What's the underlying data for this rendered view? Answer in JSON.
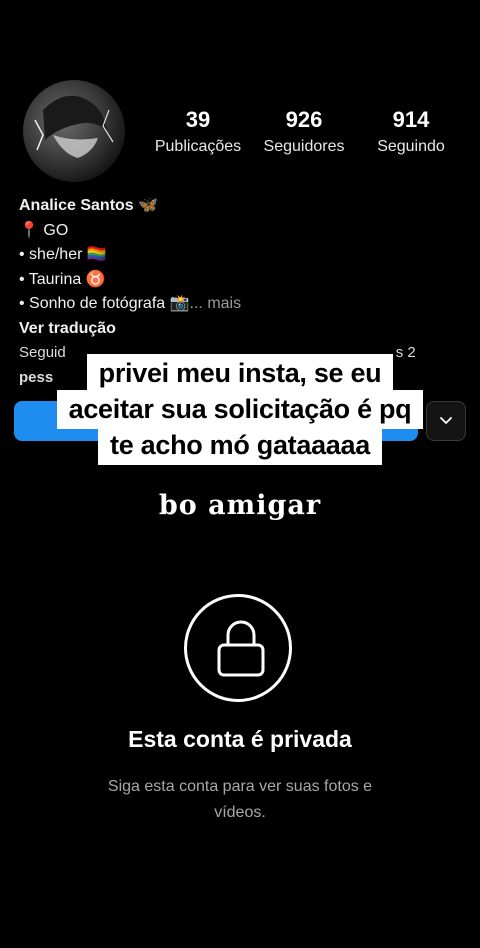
{
  "profile": {
    "stats": [
      {
        "value": "39",
        "label": "Publicações"
      },
      {
        "value": "926",
        "label": "Seguidores"
      },
      {
        "value": "914",
        "label": "Seguindo"
      }
    ],
    "bio": {
      "name": "Analice Santos 🦋",
      "location": "📍 GO",
      "pronouns": "• she/her 🏳️‍🌈",
      "sign": "• Taurina ♉",
      "dream": "• Sonho de fotógrafa 📸",
      "more": "... mais",
      "translate": "Ver tradução",
      "followed_by_line1": "Seguid",
      "followed_by_tail": "s 2",
      "followed_by_line2": "pess"
    }
  },
  "caption": {
    "line1": "privei meu insta, se eu",
    "line2": "aceitar sua solicitação é pq",
    "line3": "te acho mó gataaaaa"
  },
  "overlay_text": "bo amigar",
  "private": {
    "title": "Esta conta é privada",
    "subtitle": "Siga esta conta para ver suas fotos e vídeos."
  },
  "icons": {
    "lock": "lock-icon",
    "dropdown": "chevron-down-icon"
  },
  "colors": {
    "background": "#000000",
    "follow_button": "#1f8cf0"
  }
}
